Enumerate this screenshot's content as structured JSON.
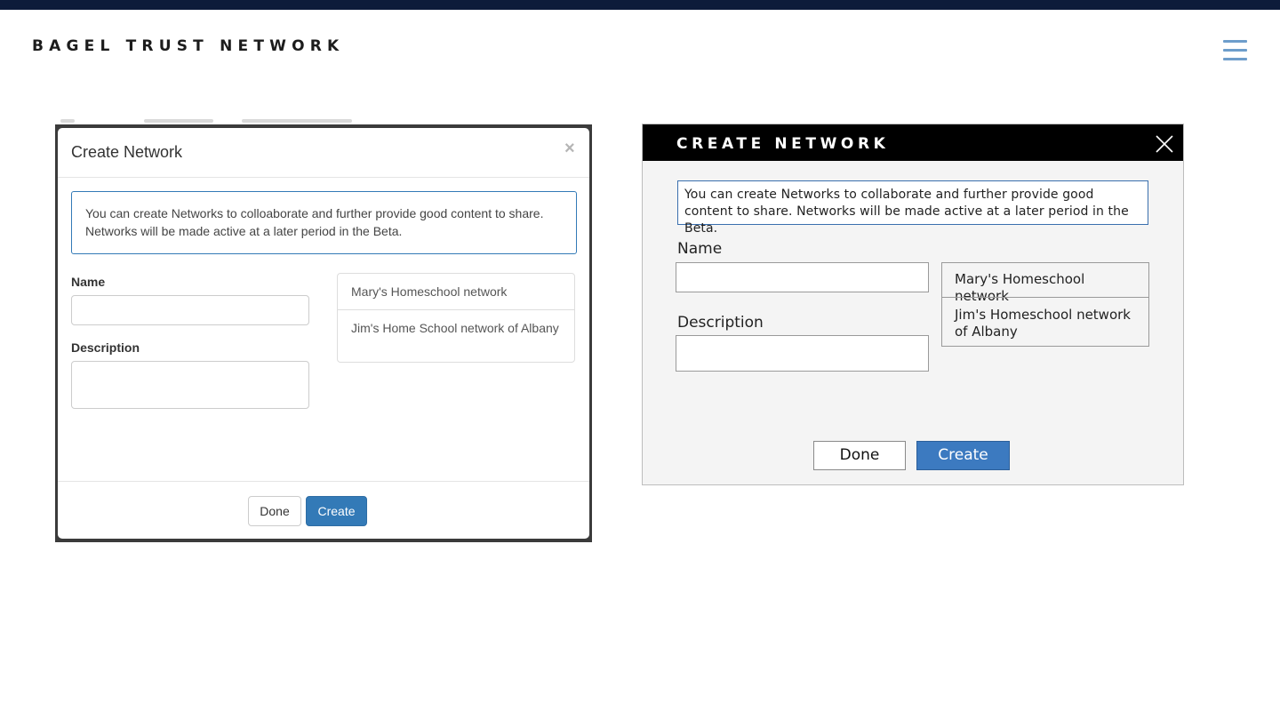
{
  "header": {
    "brand": "BAGEL TRUST NETWORK",
    "menu_icon": "hamburger-menu-icon",
    "top_bar_color": "#0d1b3a",
    "menu_icon_color": "#6d9dcb"
  },
  "modal_bootstrap": {
    "title": "Create Network",
    "close_symbol": "×",
    "info_text": "You can create Networks to colloaborate and further provide good content to share. Networks will be made active at a later period in the Beta.",
    "name_label": "Name",
    "name_value": "",
    "description_label": "Description",
    "description_value": "",
    "networks": [
      "Mary's Homeschool network",
      "Jim's Home School network of Albany"
    ],
    "done_label": "Done",
    "create_label": "Create",
    "accent_color": "#337ab7"
  },
  "modal_styled": {
    "title": "CREATE NETWORK",
    "close_icon": "close-x-icon",
    "info_text": "You can create Networks to collaborate and further provide good content to share. Networks will be made active at a later period in the Beta.",
    "name_label": "Name",
    "name_value": "",
    "description_label": "Description",
    "description_value": "",
    "networks": [
      "Mary's Homeschool network",
      "Jim's Homeschool network of Albany"
    ],
    "done_label": "Done",
    "create_label": "Create",
    "accent_color": "#3c7ac0",
    "header_color": "#000000"
  }
}
